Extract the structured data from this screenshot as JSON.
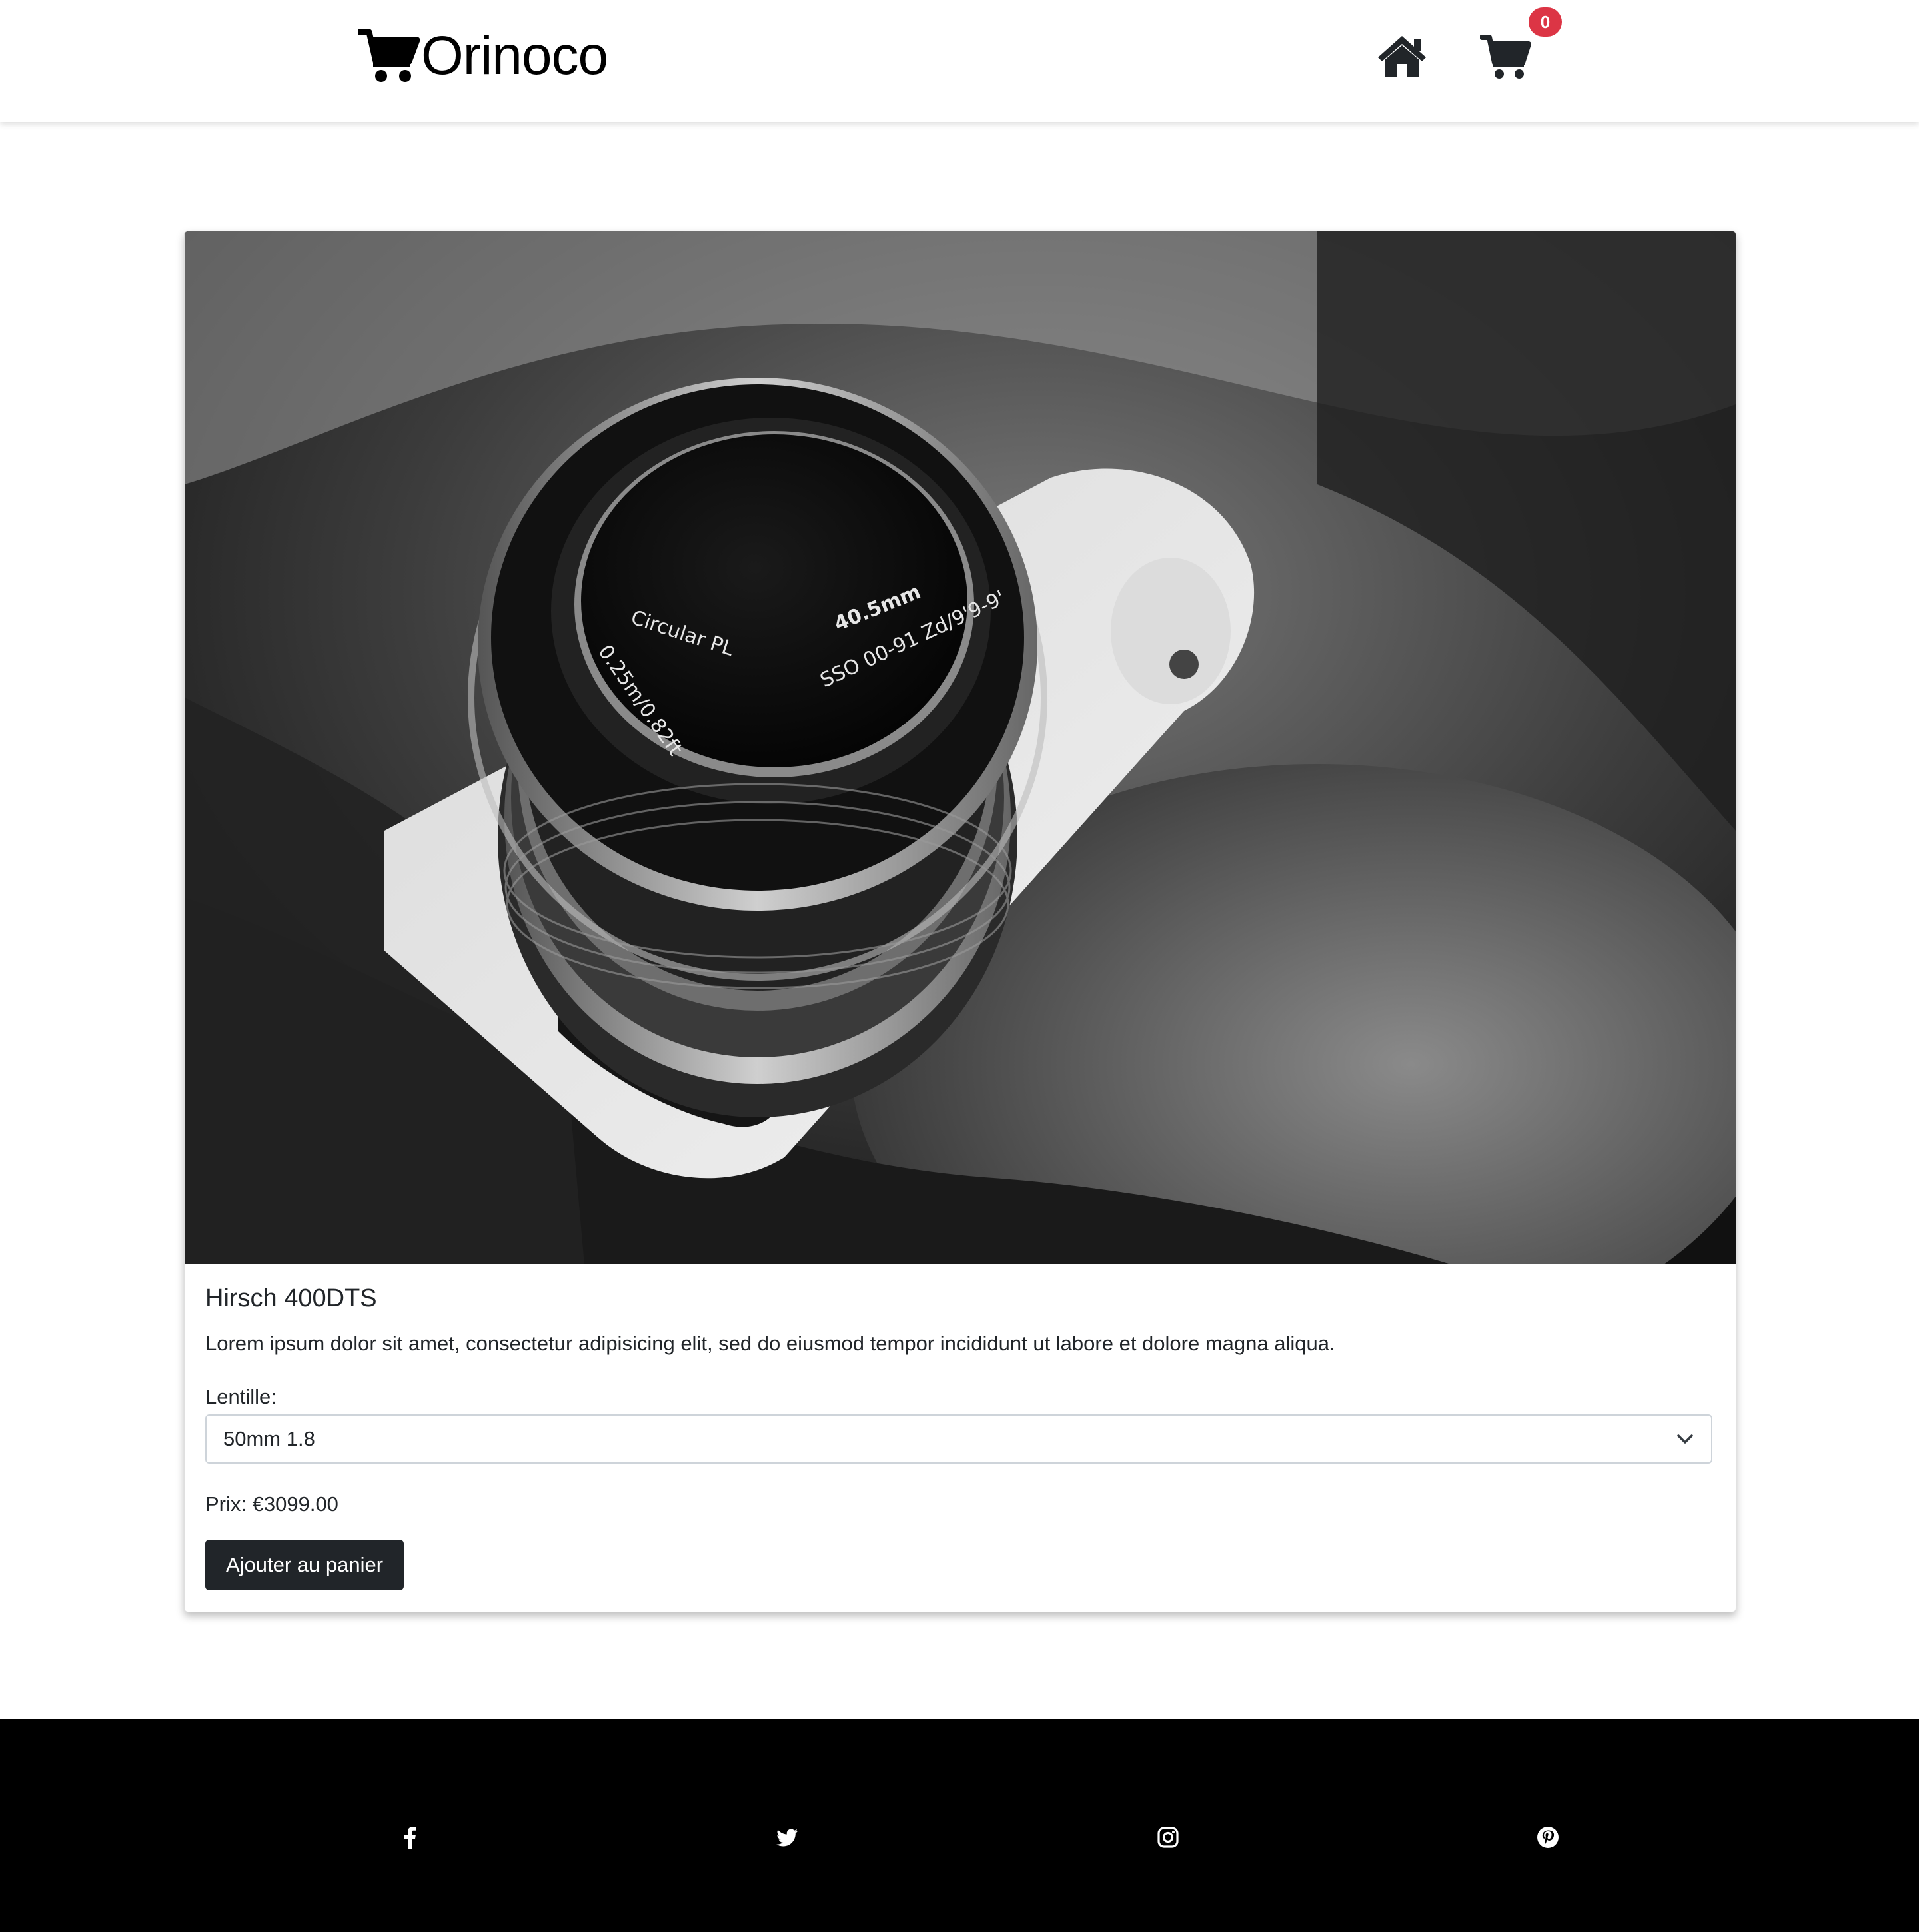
{
  "header": {
    "brand_name": "Orinoco",
    "brand_icon": "cart-icon",
    "nav": {
      "home_icon": "home-icon",
      "cart_icon": "cart-icon",
      "cart_count": "0"
    },
    "badge_color": "#dc3545"
  },
  "product": {
    "image_description_icon": "camera-photo",
    "name": "Hirsch 400DTS",
    "description": "Lorem ipsum dolor sit amet, consectetur adipisicing elit, sed do eiusmod tempor incididunt ut labore et dolore magna aliqua.",
    "lens": {
      "label": "Lentille:",
      "selected": "50mm 1.8"
    },
    "price": {
      "label": "Prix:",
      "value": "€3099.00"
    },
    "add_button_label": "Ajouter au panier"
  },
  "footer": {
    "background": "#000000",
    "social_icons": [
      "facebook-icon",
      "twitter-icon",
      "instagram-icon",
      "pinterest-icon"
    ]
  }
}
